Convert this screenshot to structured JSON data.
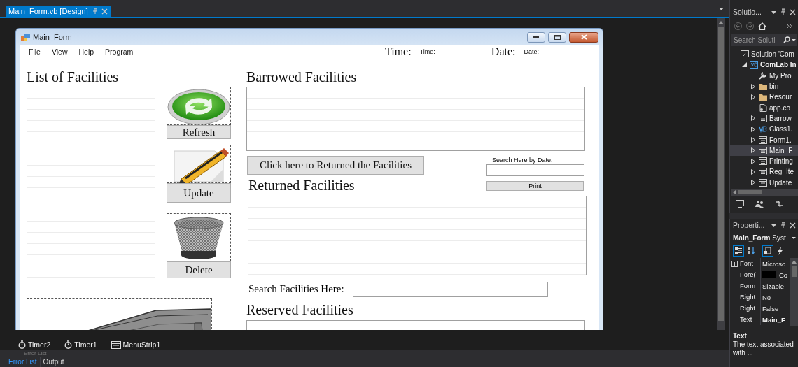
{
  "editor_tabs": [
    {
      "label": "Main_Form.vb [Design]",
      "selected": true
    }
  ],
  "form": {
    "title": "Main_Form",
    "menu": [
      "File",
      "View",
      "Help",
      "Program"
    ],
    "time_label": "Time:",
    "time_value": "Time:",
    "date_label": "Date:",
    "date_value": "Date:",
    "facilities": {
      "heading": "List of Facilities"
    },
    "action_buttons": [
      {
        "kind": "refresh",
        "label": "Refresh"
      },
      {
        "kind": "update",
        "label": "Update"
      },
      {
        "kind": "delete",
        "label": "Delete"
      }
    ],
    "borrowed": {
      "heading": "Barrowed Facilities"
    },
    "return_button": "Click here to Returned the Facilities",
    "date_search": {
      "label": "Search Here by Date:"
    },
    "print_button": "Print",
    "returned": {
      "heading": "Returned Facilities"
    },
    "facility_search": {
      "label": "Search Facilities Here:"
    },
    "reserved": {
      "heading": "Reserved Facilities"
    }
  },
  "component_tray": [
    {
      "kind": "timer",
      "label": "Timer2"
    },
    {
      "kind": "timer",
      "label": "Timer1"
    },
    {
      "kind": "menu",
      "label": "MenuStrip1"
    }
  ],
  "bottom_panel": {
    "title": "Error List",
    "tabs": [
      {
        "label": "Error List",
        "selected": true
      },
      {
        "label": "Output",
        "selected": false
      }
    ]
  },
  "solution_explorer": {
    "title": "Solutio...",
    "search": {
      "placeholder": "Search Soluti"
    },
    "tree": [
      {
        "label": "Solution 'Com",
        "kind": "solution",
        "expandable": false,
        "selected": false,
        "children": [
          {
            "label": "ComLab In",
            "kind": "project",
            "expandable": true,
            "expanded": true,
            "selected": false,
            "children": [
              {
                "label": "My Pro",
                "kind": "properties",
                "expandable": false,
                "selected": false
              },
              {
                "label": "bin",
                "kind": "folder",
                "expandable": true,
                "expanded": false,
                "selected": false
              },
              {
                "label": "Resour",
                "kind": "folder",
                "expandable": true,
                "expanded": false,
                "selected": false
              },
              {
                "label": "app.co",
                "kind": "config",
                "expandable": false,
                "selected": false
              },
              {
                "label": "Barrow",
                "kind": "form",
                "expandable": true,
                "expanded": false,
                "selected": false
              },
              {
                "label": "Class1.",
                "kind": "module",
                "expandable": true,
                "expanded": false,
                "selected": false
              },
              {
                "label": "Form1.",
                "kind": "form",
                "expandable": true,
                "expanded": false,
                "selected": false
              },
              {
                "label": "Main_F",
                "kind": "form",
                "expandable": true,
                "expanded": false,
                "selected": true
              },
              {
                "label": "Printing",
                "kind": "form",
                "expandable": true,
                "expanded": false,
                "selected": false
              },
              {
                "label": "Reg_Ite",
                "kind": "form",
                "expandable": true,
                "expanded": false,
                "selected": false
              },
              {
                "label": "Update",
                "kind": "form",
                "expandable": true,
                "expanded": false,
                "selected": false
              }
            ]
          }
        ]
      }
    ]
  },
  "properties": {
    "title": "Properti...",
    "object": "Main_Form",
    "object_type": "Syst",
    "toolbar": [
      {
        "kind": "categorized",
        "selected": true
      },
      {
        "kind": "alphabetical",
        "selected": false
      },
      {
        "kind": "properties",
        "selected": true
      },
      {
        "kind": "events",
        "selected": false
      }
    ],
    "rows": [
      {
        "name": "Font",
        "value": "Microso",
        "expandable": true,
        "modified": false
      },
      {
        "name": "Fore(",
        "value": "Co",
        "color": "#000000",
        "expandable": false,
        "modified": false
      },
      {
        "name": "Form",
        "value": "Sizable",
        "expandable": false,
        "modified": false
      },
      {
        "name": "Right",
        "value": "No",
        "expandable": false,
        "modified": false
      },
      {
        "name": "Right",
        "value": "False",
        "expandable": false,
        "modified": false
      },
      {
        "name": "Text",
        "value": "Main_F",
        "expandable": false,
        "modified": true
      }
    ],
    "description": {
      "title": "Text",
      "text": "The text associated with ..."
    }
  }
}
